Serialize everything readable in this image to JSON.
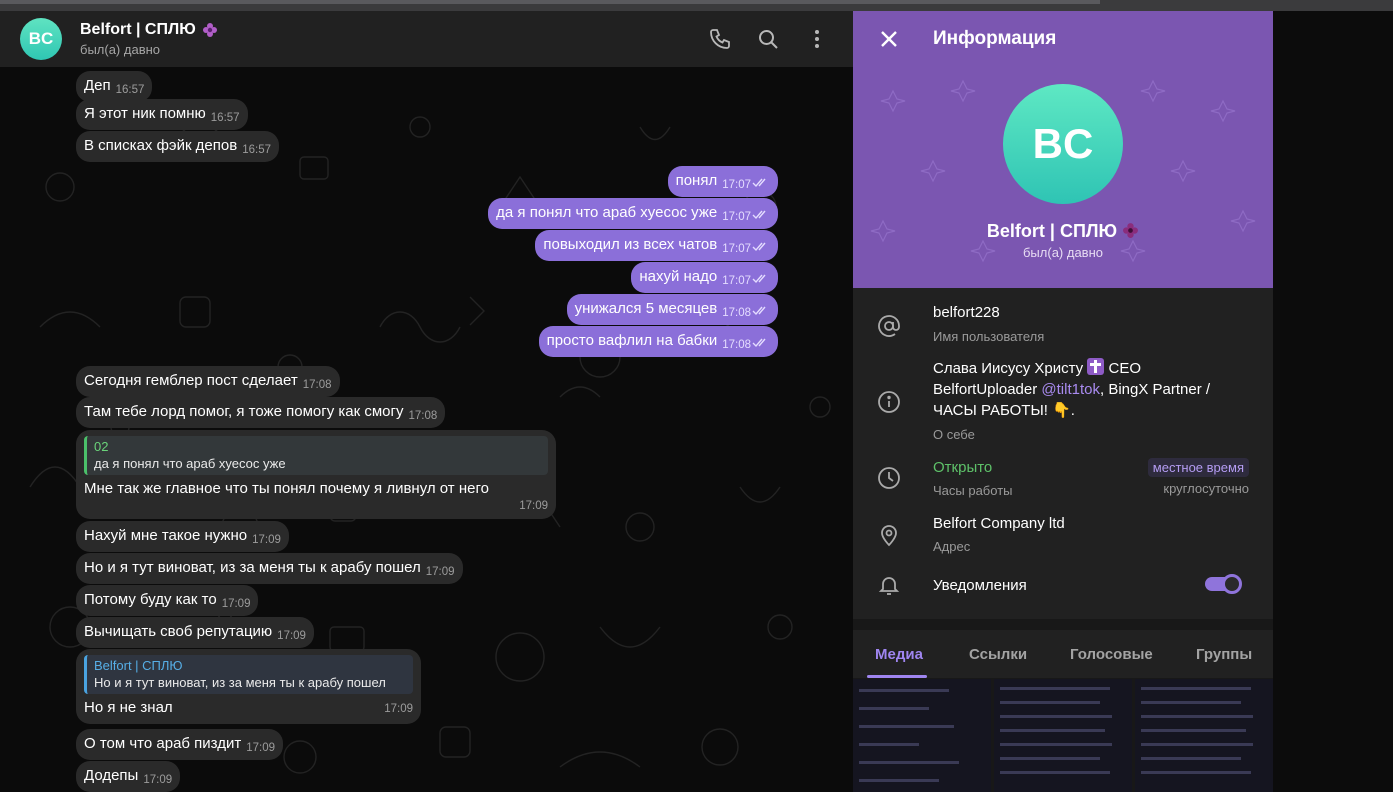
{
  "chat": {
    "name": "Belfort | СПЛЮ",
    "avatar_initials": "BC",
    "status": "был(а) давно",
    "messages_in_top": [
      {
        "text": "Деп",
        "time": "16:57"
      },
      {
        "text": "Я этот ник помню",
        "time": "16:57"
      },
      {
        "text": "В списках фэйк депов",
        "time": "16:57"
      }
    ],
    "messages_out": [
      {
        "text": "понял",
        "time": "17:07"
      },
      {
        "text": "да я понял что араб хуесос уже",
        "time": "17:07"
      },
      {
        "text": "повыходил из всех чатов",
        "time": "17:07"
      },
      {
        "text": "нахуй надо",
        "time": "17:07"
      },
      {
        "text": "унижался 5 месяцев",
        "time": "17:08"
      },
      {
        "text": "просто вафлил на бабки",
        "time": "17:08"
      }
    ],
    "messages_in_mid": [
      {
        "text": "Сегодня гемблер пост сделает",
        "time": "17:08"
      },
      {
        "text": "Там тебе лорд помог, я тоже помогу как смогу",
        "time": "17:08"
      }
    ],
    "reply1": {
      "name": "02",
      "quote": "да я понял что араб хуесос уже",
      "text": "Мне так же главное что ты понял почему я ливнул от него",
      "time": "17:09"
    },
    "messages_in_low": [
      {
        "text": "Нахуй мне такое нужно",
        "time": "17:09"
      },
      {
        "text": "Но и я тут виноват, из за меня ты к арабу пошел",
        "time": "17:09"
      },
      {
        "text": "Потому буду как то",
        "time": "17:09"
      },
      {
        "text": "Вычищать своб репутацию",
        "time": "17:09"
      }
    ],
    "reply2": {
      "name": "Belfort | СПЛЮ",
      "quote": "Но и я тут виноват, из за меня ты к арабу пошел",
      "text": "Но я не знал",
      "time": "17:09"
    },
    "messages_in_bottom": [
      {
        "text": "О том что араб пиздит",
        "time": "17:09"
      },
      {
        "text": "Додепы",
        "time": "17:09"
      }
    ]
  },
  "panel": {
    "title": "Информация",
    "avatar_initials": "BC",
    "name": "Belfort | СПЛЮ",
    "status": "был(а) давно",
    "username": "belfort228",
    "username_label": "Имя пользователя",
    "bio_line1": "Слава Иисусу Христу",
    "bio_line1b": "CEO",
    "bio_line2a": "BelfortUploader",
    "bio_link": "@tilt1tok",
    "bio_line2b": ", BingX Partner /",
    "bio_line3": "ЧАСЫ РАБОТЫ!",
    "bio_label": "О себе",
    "open_status": "Открыто",
    "hours_label": "Часы работы",
    "local_time": "местное время",
    "hours_value": "круглосуточно",
    "address": "Belfort Company ltd",
    "address_label": "Адрес",
    "notifications": "Уведомления",
    "notifications_on": true
  },
  "tabs": [
    "Медиа",
    "Ссылки",
    "Голосовые",
    "Группы"
  ],
  "colors": {
    "accent": "#8b6fd9",
    "panel_header": "#7b56b1",
    "avatar": "#3fd3ba"
  }
}
